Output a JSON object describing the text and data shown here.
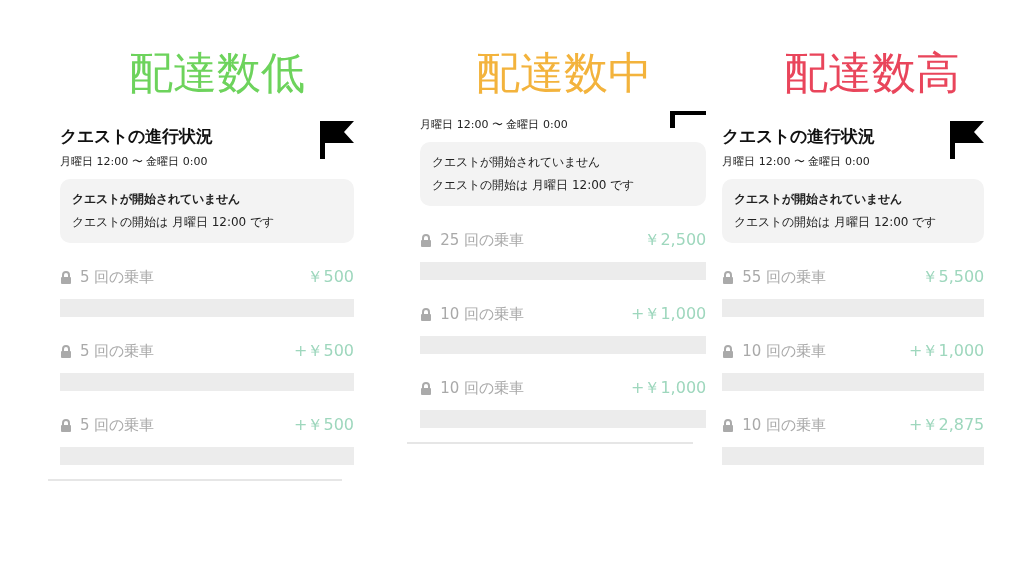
{
  "columns": [
    {
      "heading": {
        "text": "配達数低",
        "color": "#6dd35c"
      },
      "flag": {
        "kind": "full"
      },
      "title": "クエストの進行状況",
      "period": "月曜日 12:00 〜 金曜日 0:00",
      "notice": {
        "bold_first": true,
        "lines": [
          "クエストが開始されていません",
          "クエストの開始は 月曜日 12:00 です"
        ]
      },
      "tiers": [
        {
          "label": "5 回の乗車",
          "amount": "￥500",
          "locked": true,
          "level": 0
        },
        {
          "label": "5 回の乗車",
          "amount": "+￥500",
          "locked": true,
          "level": 0
        },
        {
          "label": "5 回の乗車",
          "amount": "+￥500",
          "locked": true,
          "level": 0
        }
      ],
      "bottom_rule": true
    },
    {
      "heading": {
        "text": "配達数中",
        "color": "#f3b33c"
      },
      "flag": {
        "kind": "cropped"
      },
      "period": "月曜日 12:00 〜 金曜日 0:00",
      "notice": {
        "bold_first": false,
        "lines": [
          "クエストが開始されていません",
          "クエストの開始は 月曜日 12:00 です"
        ]
      },
      "tiers": [
        {
          "label": "25 回の乗車",
          "amount": "￥2,500",
          "locked": true,
          "level": 0
        },
        {
          "label": "10 回の乗車",
          "amount": "+￥1,000",
          "locked": true,
          "level": 0
        },
        {
          "label": "10 回の乗車",
          "amount": "+￥1,000",
          "locked": true,
          "level": 0
        }
      ],
      "bottom_rule": true
    },
    {
      "heading": {
        "text": "配達数高",
        "color": "#e9455b"
      },
      "flag": {
        "kind": "full"
      },
      "title": "クエストの進行状況",
      "period": "月曜日 12:00 〜 金曜日 0:00",
      "notice": {
        "bold_first": true,
        "lines": [
          "クエストが開始されていません",
          "クエストの開始は 月曜日 12:00 です"
        ]
      },
      "tiers": [
        {
          "label": "55 回の乗車",
          "amount": "￥5,500",
          "locked": true,
          "level": 0
        },
        {
          "label": "10 回の乗車",
          "amount": "+￥1,000",
          "locked": true,
          "level": 0
        },
        {
          "label": "10 回の乗車",
          "amount": "+￥2,875",
          "locked": true,
          "level": 0
        }
      ]
    }
  ]
}
